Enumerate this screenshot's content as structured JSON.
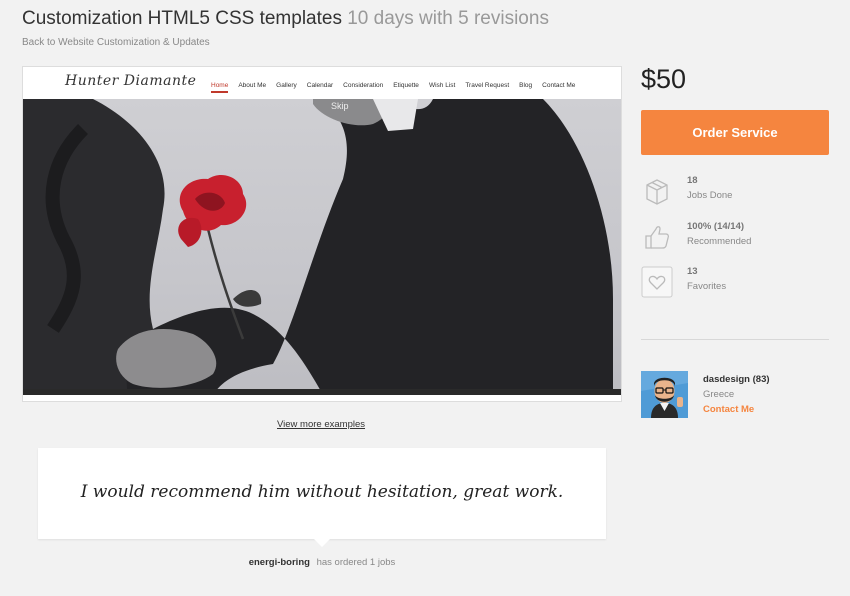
{
  "header": {
    "title": "Customization HTML5 CSS templates",
    "subtitle": "10 days with 5 revisions",
    "breadcrumb": "Back to Website Customization & Updates"
  },
  "preview": {
    "logo": "Hunter Diamante",
    "nav": [
      "Home",
      "About Me",
      "Gallery",
      "Calendar",
      "Consideration",
      "Etiquette",
      "Wish List",
      "Travel Request",
      "Blog",
      "Contact Me"
    ],
    "active_nav": "Home",
    "skip": "Skip",
    "more_examples": "View more examples"
  },
  "sidebar": {
    "price": "$50",
    "order_label": "Order Service",
    "stats": [
      {
        "icon": "box-icon",
        "value": "18",
        "label": "Jobs Done"
      },
      {
        "icon": "thumbs-up-icon",
        "value": "100% (14/14)",
        "label": "Recommended"
      },
      {
        "icon": "heart-icon",
        "value": "13",
        "label": "Favorites"
      }
    ],
    "seller": {
      "name": "dasdesign (83)",
      "country": "Greece",
      "contact_label": "Contact Me"
    }
  },
  "review": {
    "quote": "I would recommend him without hesitation, great work.",
    "reviewer": "energi-boring",
    "meta": "has ordered 1 jobs"
  },
  "colors": {
    "accent": "#f5853f",
    "background": "#f2f2f2",
    "nav_active": "#c0392b"
  }
}
